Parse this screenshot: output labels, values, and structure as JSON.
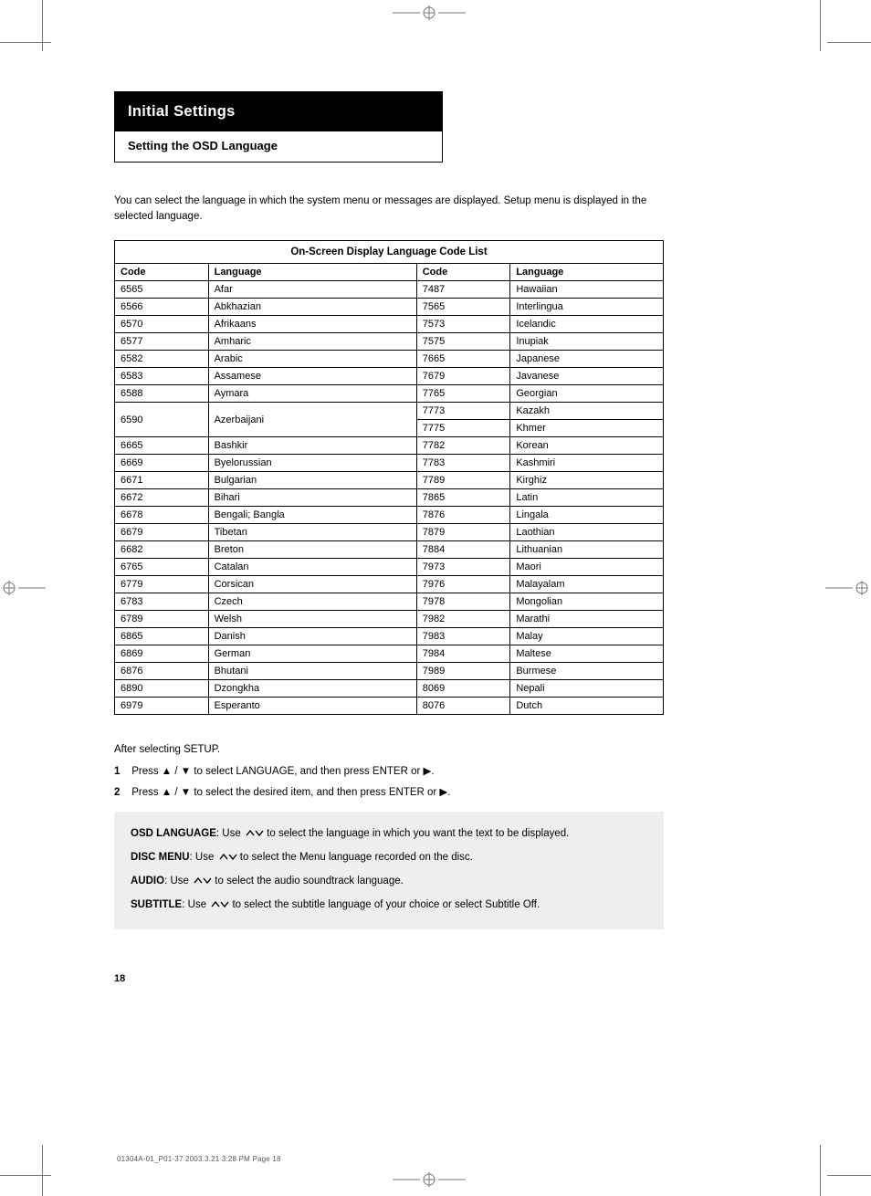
{
  "header": {
    "title": "Initial Settings",
    "subtitle": "Setting the OSD Language"
  },
  "intro_text": "You can select the language in which the system menu or messages are displayed. Setup menu is displayed in the selected language.",
  "table": {
    "title": "On-Screen Display Language Code List",
    "columns": [
      "Code",
      "Language",
      "Code",
      "Language"
    ],
    "rows": [
      [
        "6565",
        "Afar",
        "7487",
        "Hawaiian"
      ],
      [
        "6566",
        "Abkhazian",
        "7565",
        "Interlingua"
      ],
      [
        "6570",
        "Afrikaans",
        "7573",
        "Icelandic"
      ],
      [
        "6577",
        "Amharic",
        "7575",
        "Inupiak"
      ],
      [
        "6582",
        "Arabic",
        "7665",
        "Japanese"
      ],
      [
        "6583",
        "Assamese",
        "7679",
        "Javanese"
      ],
      [
        "6588",
        "Aymara",
        "7765",
        "Georgian"
      ],
      [
        {
          "code": "6590",
          "lang": "Azerbaijani",
          "rowspan": 2
        },
        [
          [
            "7773",
            "Kazakh"
          ],
          [
            "7775",
            "Khmer"
          ]
        ]
      ],
      [
        "6665",
        "Bashkir",
        "7782",
        "Korean"
      ],
      [
        "6669",
        "Byelorussian",
        "7783",
        "Kashmiri"
      ],
      [
        "6671",
        "Bulgarian",
        "7789",
        "Kirghiz"
      ],
      [
        "6672",
        "Bihari",
        "7865",
        "Latin"
      ],
      [
        "6678",
        "Bengali; Bangla",
        "7876",
        "Lingala"
      ],
      [
        "6679",
        "Tibetan",
        "7879",
        "Laothian"
      ],
      [
        "6682",
        "Breton",
        "7884",
        "Lithuanian"
      ],
      [
        "6765",
        "Catalan",
        "7973",
        "Maori"
      ],
      [
        "6779",
        "Corsican",
        "7976",
        "Malayalam"
      ],
      [
        "6783",
        "Czech",
        "7978",
        "Mongolian"
      ],
      [
        "6789",
        "Welsh",
        "7982",
        "Marathi"
      ],
      [
        "6865",
        "Danish",
        "7983",
        "Malay"
      ],
      [
        "6869",
        "German",
        "7984",
        "Maltese"
      ],
      [
        "6876",
        "Bhutani",
        "7989",
        "Burmese"
      ],
      [
        "6890",
        "Dzongkha",
        "8069",
        "Nepali"
      ],
      [
        "6979",
        "Esperanto",
        "8076",
        "Dutch"
      ]
    ]
  },
  "instructions": {
    "lead": "After selecting SETUP.",
    "steps": [
      "Press ▲ / ▼ to select LANGUAGE, and then press ENTER or ▶.",
      "Press ▲ / ▼ to select the desired item, and then press ENTER or ▶."
    ]
  },
  "option_box": {
    "items": [
      {
        "label": "OSD LANGUAGE",
        "body": "Use ▲ / ▼ to select the language in which you want the text to be displayed."
      },
      {
        "label": "DISC MENU",
        "body": "Use ▲ / ▼ to select the Menu language recorded on the disc."
      },
      {
        "label": "AUDIO",
        "body": "Use ▲ / ▼ to select the audio soundtrack language."
      },
      {
        "label": "SUBTITLE",
        "body": "Use ▲ / ▼ to select the subtitle language of your choice or select Subtitle Off."
      }
    ]
  },
  "page_number": "18",
  "footer": "01304A-01_P01-37  2003.3.21  3:28 PM  Page 18"
}
